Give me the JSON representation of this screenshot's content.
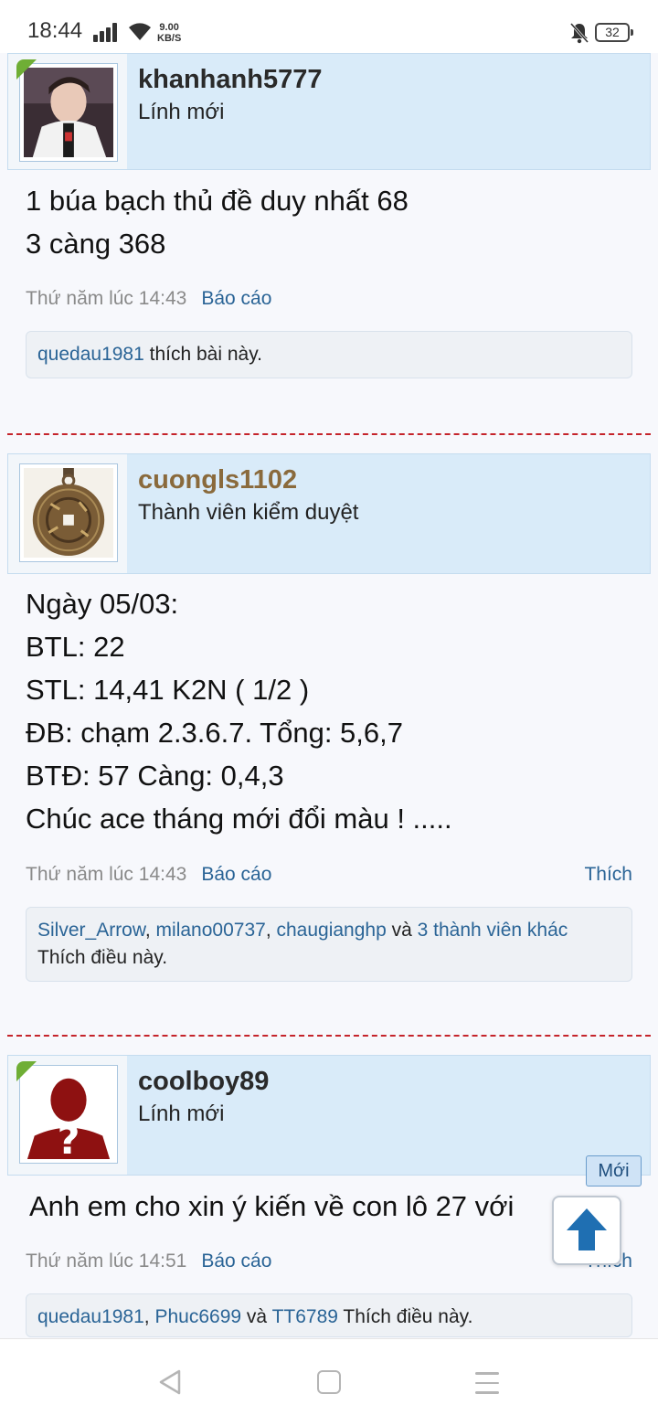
{
  "status_bar": {
    "time": "18:44",
    "net_speed": "9.00",
    "net_unit": "KB/S",
    "battery": "32",
    "icons": [
      "signal-icon",
      "wifi-icon",
      "bell-muted-icon",
      "battery-icon"
    ]
  },
  "posts": [
    {
      "username": "khanhanh5777",
      "user_title": "Lính mới",
      "message": [
        "1 búa bạch thủ đề duy nhất 68",
        "3 càng 368"
      ],
      "timestamp": "Thứ năm lúc 14:43",
      "report": "Báo cáo",
      "likes": {
        "users": [
          "quedau1981"
        ],
        "suffix": "thích bài này."
      }
    },
    {
      "username": "cuongls1102",
      "user_title": "Thành viên kiểm duyệt",
      "message": [
        "Ngày 05/03:",
        "BTL: 22",
        "STL: 14,41 K2N ( 1/2 )",
        "ĐB: chạm 2.3.6.7. Tổng: 5,6,7",
        "BTĐ: 57 Càng: 0,4,3",
        "Chúc ace tháng mới đổi màu ! ....."
      ],
      "timestamp": "Thứ năm lúc 14:43",
      "report": "Báo cáo",
      "like_action": "Thích",
      "likes": {
        "users": [
          "Silver_Arrow",
          "milano00737",
          "chaugianghp"
        ],
        "and": "và",
        "others": "3 thành viên khác",
        "suffix": "Thích điều này."
      }
    },
    {
      "username": "coolboy89",
      "user_title": "Lính mới",
      "message": [
        "Anh em cho xin ý kiến về con lô 27 với"
      ],
      "timestamp": "Thứ năm lúc 14:51",
      "report": "Báo cáo",
      "like_action": "Thích",
      "likes": {
        "users": [
          "quedau1981",
          "Phuc6699"
        ],
        "and": "và",
        "last": "TT6789",
        "suffix": "Thích điều này."
      }
    }
  ],
  "new_badge": "Mới",
  "colors": {
    "link": "#2a6496",
    "divider": "#c5242b",
    "header_bg": "#d9ebf9",
    "online_flag": "#6fae35"
  }
}
